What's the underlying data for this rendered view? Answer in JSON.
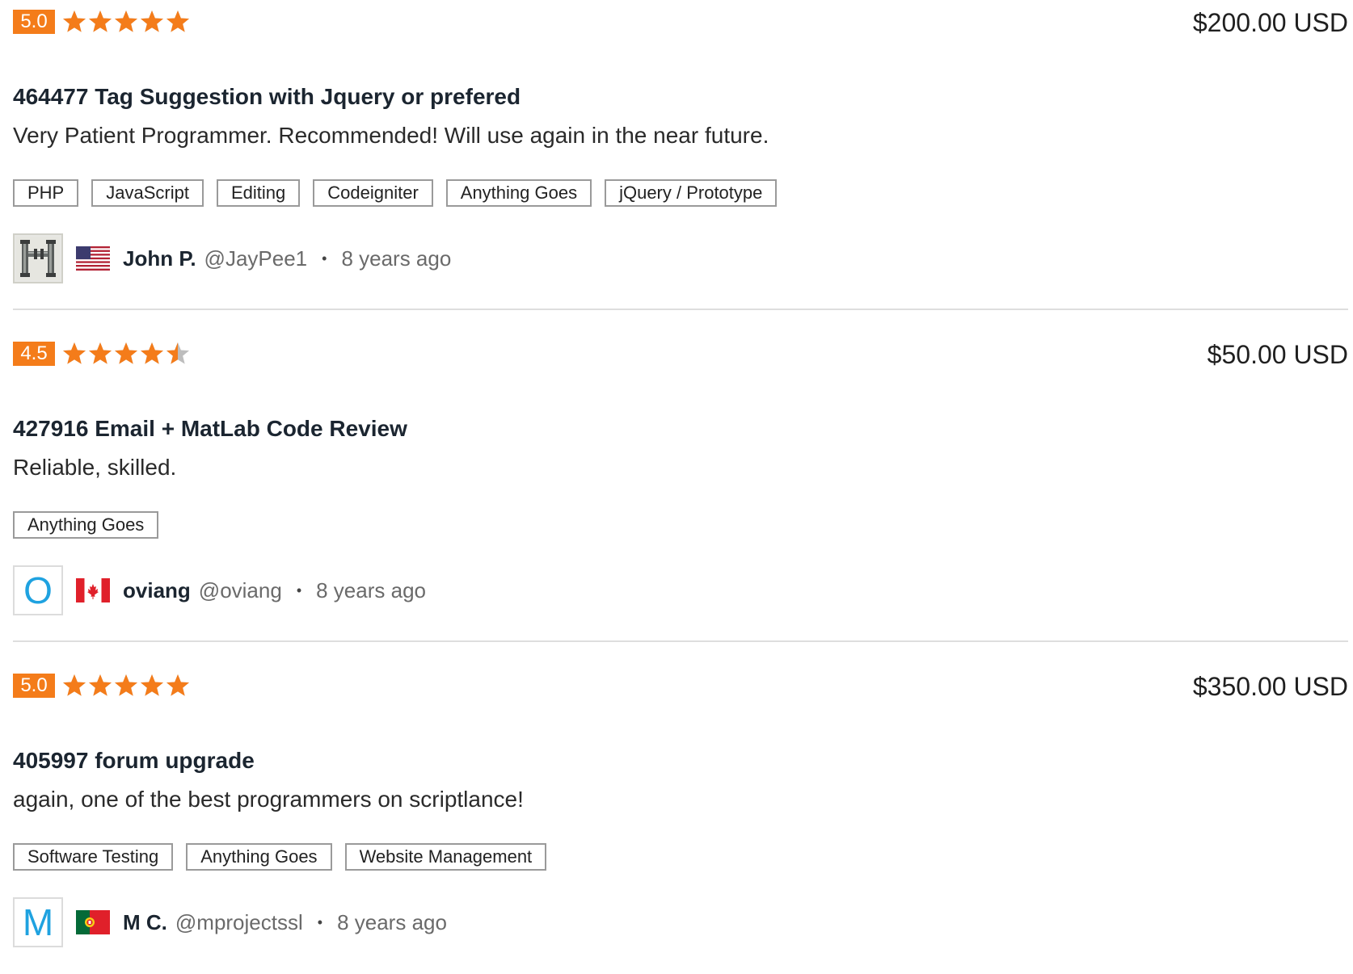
{
  "colors": {
    "accent": "#f47c1a",
    "star_empty": "#bdbdbd",
    "avatar_letter": "#1fa2e0"
  },
  "reviews": [
    {
      "rating": "5.0",
      "stars": 5,
      "price": "$200.00 USD",
      "title": "464477 Tag Suggestion with Jquery or prefered",
      "comment": "Very Patient Programmer. Recommended! Will use again in the near future.",
      "tags": [
        "PHP",
        "JavaScript",
        "Editing",
        "Codeigniter",
        "Anything Goes",
        "jQuery / Prototype"
      ],
      "author": {
        "avatar": "pipes-image",
        "flag": "us-flag",
        "name": "John P.",
        "handle": "@JayPee1",
        "time": "8 years ago"
      }
    },
    {
      "rating": "4.5",
      "stars": 4.5,
      "price": "$50.00 USD",
      "title": "427916 Email + MatLab Code Review",
      "comment": "Reliable, skilled.",
      "tags": [
        "Anything Goes"
      ],
      "author": {
        "avatar": "O",
        "flag": "canada-flag",
        "name": "oviang",
        "handle": "@oviang",
        "time": "8 years ago"
      }
    },
    {
      "rating": "5.0",
      "stars": 5,
      "price": "$350.00 USD",
      "title": "405997 forum upgrade",
      "comment": "again, one of the best programmers on scriptlance!",
      "tags": [
        "Software Testing",
        "Anything Goes",
        "Website Management"
      ],
      "author": {
        "avatar": "M",
        "flag": "portugal-flag",
        "name": "M C.",
        "handle": "@mprojectssl",
        "time": "8 years ago"
      }
    }
  ],
  "separator": "•"
}
